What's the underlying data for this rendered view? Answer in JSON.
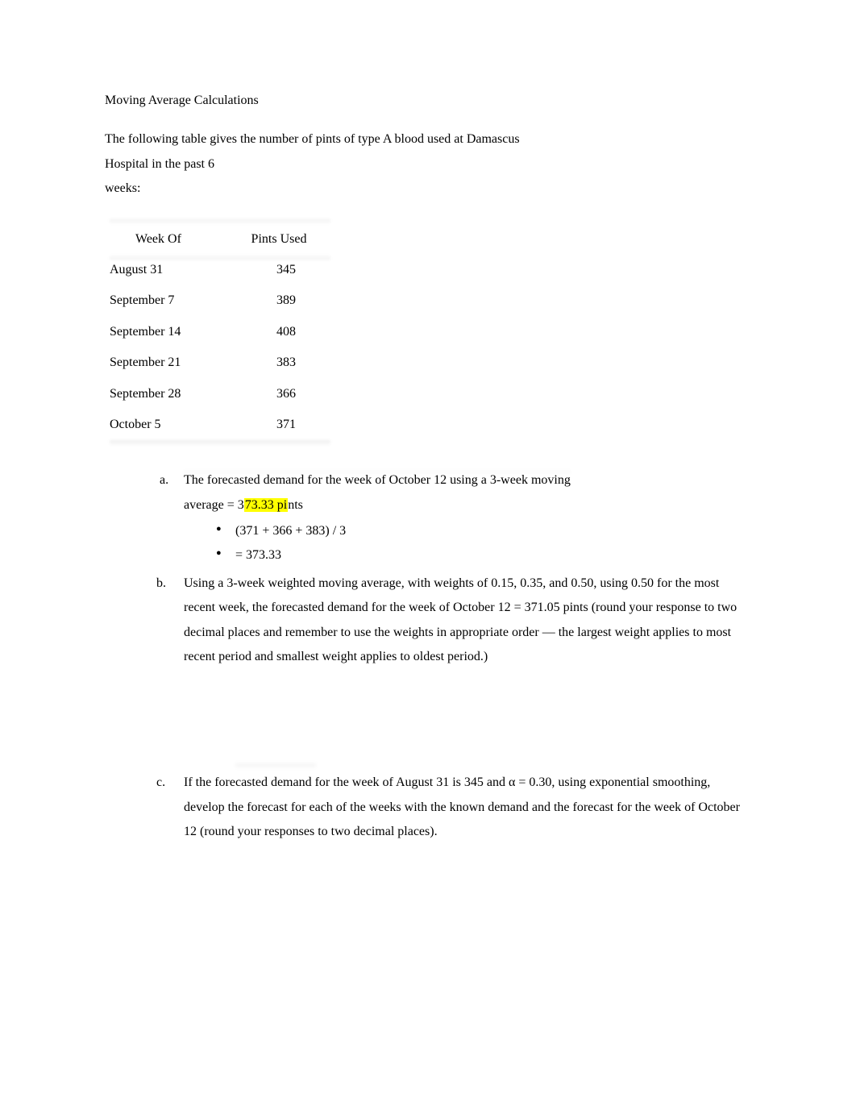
{
  "title": "Moving Average Calculations",
  "intro": {
    "line1": "The following table gives the number of pints of type A blood used at Damascus",
    "line2": "Hospital in the past 6",
    "line3": "weeks:"
  },
  "table": {
    "headers": {
      "week": "Week Of",
      "pints": "Pints Used"
    },
    "rows": [
      {
        "week": "August 31",
        "pints": "345"
      },
      {
        "week": "September 7",
        "pints": "389"
      },
      {
        "week": "September 14",
        "pints": "408"
      },
      {
        "week": "September 21",
        "pints": "383"
      },
      {
        "week": "September 28",
        "pints": "366"
      },
      {
        "week": "October 5",
        "pints": "371"
      }
    ]
  },
  "questions": {
    "a": {
      "marker": "a.",
      "line1": " The forecasted demand for the week of October 12 using a 3-week moving",
      "line2_prefix": "average = ",
      "highlight_pre": "3",
      "highlight_mid": "73.33 pi",
      "line2_suffix": "nts",
      "bullets": [
        "(371 + 366 + 383) / 3",
        "= 373.33"
      ]
    },
    "b": {
      "marker": "b.",
      "text": "Using a 3-week weighted moving average, with weights of 0.15, 0.35, and 0.50, using 0.50 for the most recent week, the forecasted demand for the week of October 12 = 371.05 pints     (round your response to two decimal places and remember to use the weights in appropriate order       — the largest weight applies to most recent period and smallest weight applies to oldest period.)"
    },
    "c": {
      "marker": "c.",
      "text": "If the forecasted demand for the week of August 31 is 345 and α = 0.30, using exponential smoothing, develop the forecast for each of the weeks with the known demand and the forecast for the week of October 12        (round your responses to two decimal places)."
    }
  }
}
